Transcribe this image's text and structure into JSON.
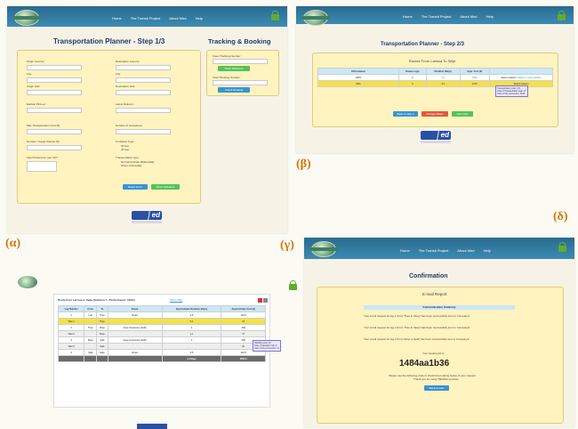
{
  "labels": {
    "a": "(α)",
    "b": "(β)",
    "c": "(γ)",
    "d": "(δ)"
  },
  "nav": [
    "Home",
    "The Transit Project",
    "About Med",
    "Help"
  ],
  "step1": {
    "title": "Transportation Planner - Step 1/3",
    "tracking_title": "Tracking & Booking",
    "fields_left": [
      "Origin Country:",
      "City:",
      "Origin Hub:",
      "Earliest Pick-up:",
      "Max Transportation Cost (€):",
      "Number / Cargo Volume (€):",
      "Fleet Preference (per lot)?"
    ],
    "fields_right": [
      "Destination Country:",
      "City:",
      "Destination Hub:",
      "Latest Delivery:",
      "Number of Containers:",
      "Container Type:",
      "Transportation type:"
    ],
    "container_options": [
      "20 feet",
      "40 feet"
    ],
    "transport_options": [
      "Normal (include Multimodal)",
      "Direct (Unimodal)"
    ],
    "reset": "Reset Form",
    "show": "Show Solutions",
    "tracking_label": "Insert Tracking Number:",
    "track_btn": "Track Shipment",
    "booking_label": "Insert Booking Number:",
    "booking_btn": "Check Booking"
  },
  "step2": {
    "title": "Transportation Planner - Step 2/3",
    "routes_title": "Routes From Larissa To Selje",
    "headers": [
      "Performance",
      "Routes Legs",
      "Duration (Days)",
      "Appr. Cost (€)",
      ""
    ],
    "rows": [
      {
        "perf": "100%",
        "legs": "3",
        "dur": "4.1",
        "cost": "1054",
        "sel": "Select solution",
        "more": "Solution 1 (view details)"
      },
      {
        "perf": "94%",
        "legs": "3",
        "dur": "4.1",
        "cost": "1173",
        "sel": "Select solution",
        "more": ""
      }
    ],
    "tooltip": [
      "Transportation Cost: 171",
      "Cost of Transportation legs: 17",
      "Cost of City connection: 1133"
    ],
    "back": "Back to step 1",
    "change": "Change Filters",
    "next": "Next step"
  },
  "solution": {
    "caption": "Route from Larissa to Selje (Solution 1 - Performance: 100%)",
    "showmore": "Show Map",
    "headers": [
      "Leg Number",
      "From",
      "To",
      "Route",
      "Approximate Duration (days)",
      "Approximate Cost (€)"
    ],
    "rows": [
      [
        "1",
        "Lari",
        "Thes",
        "Road",
        "0.5",
        "110.5"
      ],
      [
        "Wait 1",
        "",
        "Thes",
        "",
        "0.1",
        "13"
      ],
      [
        "2",
        "Thes",
        "Skop",
        "Area component (both)",
        "1",
        "403"
      ],
      [
        "Wait 2",
        "",
        "Skop",
        "",
        "1.1",
        "37"
      ],
      [
        "3",
        "Skop",
        "Split",
        "Area component (both)",
        "1",
        "235"
      ],
      [
        "Wait 3",
        "",
        "Split",
        "",
        "",
        "20"
      ],
      [
        "4",
        "Split",
        "Selje",
        "Road",
        "0.5",
        "110.5"
      ],
      [
        "",
        "",
        "",
        "",
        "4.1 Days",
        "1054 €"
      ]
    ],
    "tooltip": [
      "Handling cost: 13",
      "Cost of transition hub: 2",
      "Cost of city connection: 11"
    ]
  },
  "confirm": {
    "title": "Confirmation",
    "report": "E-mail Report",
    "summary": "Communication Summary",
    "lines": [
      "Your email request for leg 1 (from Thes to Skop) has been successfully sent to Company1",
      "Your email request for leg 2 (from Thes to Skop) has been successfully sent to Company2",
      "Your email request for leg 2 (from Skop to Split) has been successfully sent to Company3"
    ],
    "booking_label": "Your booking ID is:",
    "booking_id": "1484aa1b36",
    "note1": "Please use the following code to check the booking status of your request.",
    "note2": "Thank you for using TRANSit services.",
    "back": "Back at start"
  },
  "colors": {
    "accent": "#3a93d6",
    "panel": "#fff3bf",
    "highlight": "#f4e04a"
  }
}
